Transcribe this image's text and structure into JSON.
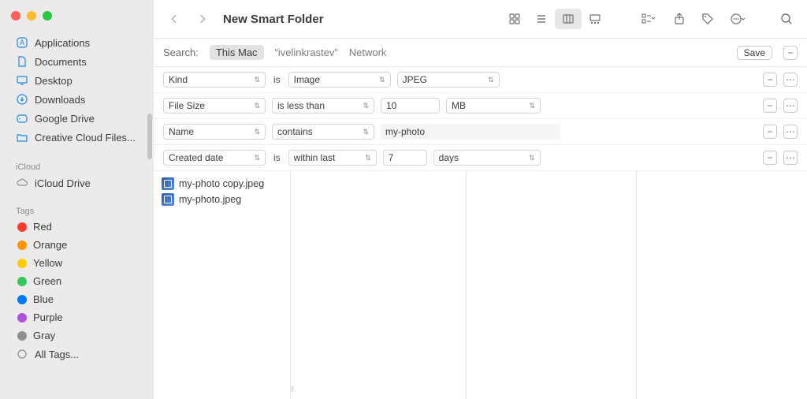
{
  "window": {
    "title": "New Smart Folder"
  },
  "sidebar": {
    "favorites": [
      {
        "label": "Applications",
        "icon": "applications"
      },
      {
        "label": "Documents",
        "icon": "documents"
      },
      {
        "label": "Desktop",
        "icon": "desktop"
      },
      {
        "label": "Downloads",
        "icon": "downloads"
      },
      {
        "label": "Google Drive",
        "icon": "drive"
      },
      {
        "label": "Creative Cloud Files...",
        "icon": "folder"
      }
    ],
    "icloud_label": "iCloud",
    "icloud": [
      {
        "label": "iCloud Drive",
        "icon": "cloud"
      }
    ],
    "tags_label": "Tags",
    "tags": [
      {
        "label": "Red",
        "color": "#ff3b30"
      },
      {
        "label": "Orange",
        "color": "#ff9500"
      },
      {
        "label": "Yellow",
        "color": "#ffcc00"
      },
      {
        "label": "Green",
        "color": "#34c759"
      },
      {
        "label": "Blue",
        "color": "#007aff"
      },
      {
        "label": "Purple",
        "color": "#af52de"
      },
      {
        "label": "Gray",
        "color": "#8e8e93"
      }
    ],
    "all_tags_label": "All Tags..."
  },
  "search": {
    "label": "Search:",
    "scopes": [
      {
        "label": "This Mac",
        "active": true
      },
      {
        "label": "“ivelinkrastev”",
        "active": false
      },
      {
        "label": "Network",
        "active": false
      }
    ],
    "save_label": "Save"
  },
  "criteria": [
    {
      "attr": "Kind",
      "joiner": "is",
      "op": "Image",
      "val": "JPEG",
      "layout": "kind"
    },
    {
      "attr": "File Size",
      "joiner": "",
      "op": "is less than",
      "num": "10",
      "unit": "MB",
      "layout": "size"
    },
    {
      "attr": "Name",
      "joiner": "",
      "op": "contains",
      "text": "my-photo",
      "layout": "name"
    },
    {
      "attr": "Created date",
      "joiner": "is",
      "op": "within last",
      "num": "7",
      "unit": "days",
      "layout": "date"
    }
  ],
  "results": {
    "files": [
      {
        "name": "my-photo copy.jpeg"
      },
      {
        "name": "my-photo.jpeg"
      }
    ]
  }
}
